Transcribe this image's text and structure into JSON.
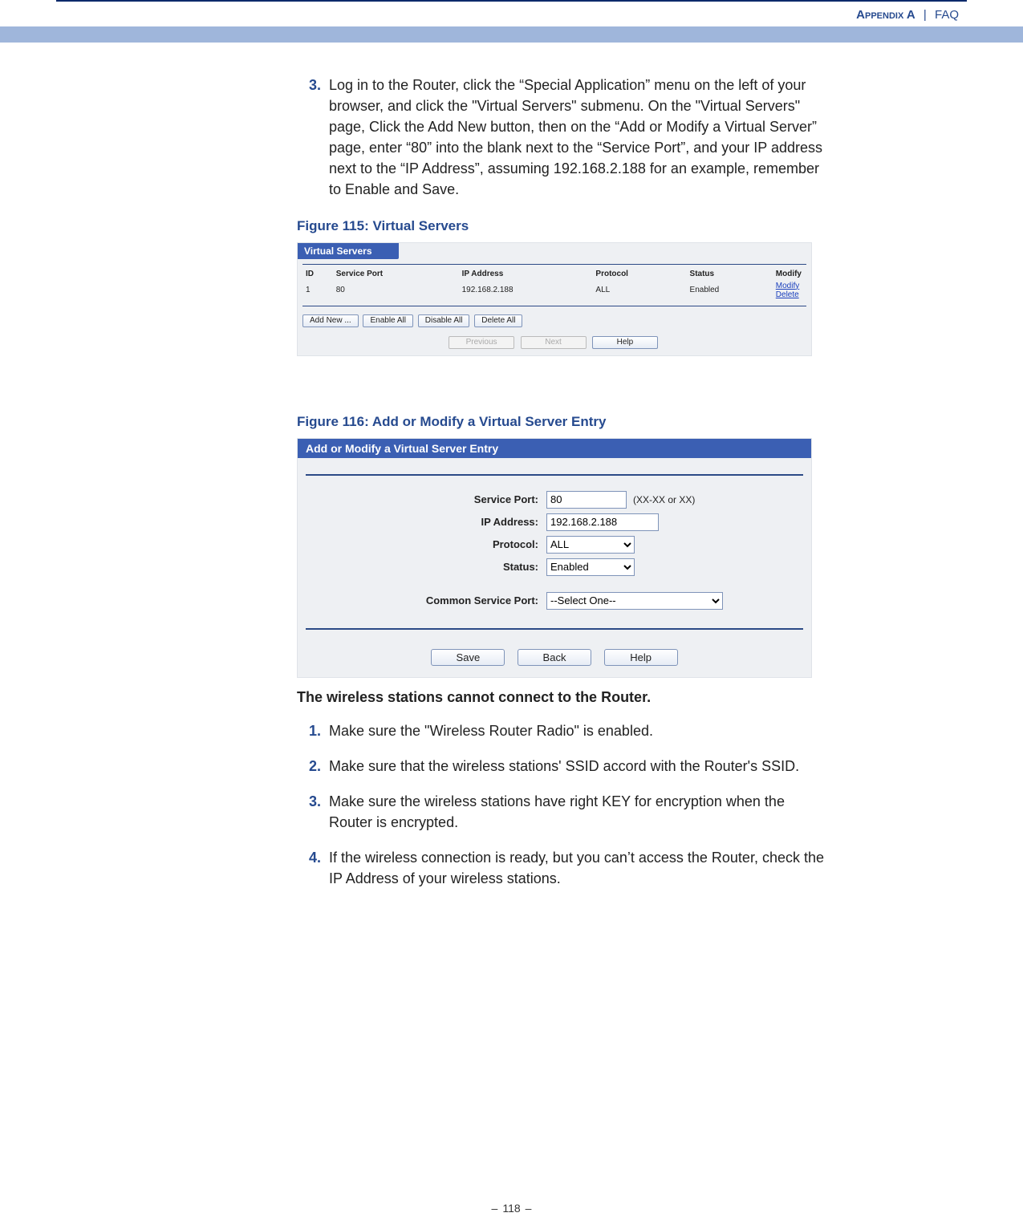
{
  "header": {
    "appendix": "Appendix A",
    "sep": "|",
    "section": "FAQ"
  },
  "step3": {
    "num": "3.",
    "text": "Log in to the Router, click the “Special Application” menu on the left of your browser, and click the \"Virtual Servers\" submenu. On the \"Virtual Servers\" page, Click the Add New button, then on the “Add or Modify a Virtual Server” page, enter “80” into the blank next to the “Service Port”, and your IP address next to the “IP Address”, assuming 192.168.2.188 for an example, remember to Enable and Save."
  },
  "fig115": {
    "caption": "Figure 115:  Virtual Servers",
    "title": "Virtual Servers",
    "cols": {
      "id": "ID",
      "sp": "Service Port",
      "ip": "IP Address",
      "proto": "Protocol",
      "status": "Status",
      "modify": "Modify"
    },
    "row": {
      "id": "1",
      "sp": "80",
      "ip": "192.168.2.188",
      "proto": "ALL",
      "status": "Enabled",
      "modify": "Modify",
      "delete": "Delete"
    },
    "btns": {
      "add": "Add New ...",
      "ena": "Enable All",
      "dis": "Disable All",
      "del": "Delete All"
    },
    "nav": {
      "prev": "Previous",
      "next": "Next",
      "help": "Help"
    }
  },
  "fig116": {
    "caption": "Figure 116:  Add or Modify a Virtual Server Entry",
    "title": "Add or Modify a Virtual Server Entry",
    "labels": {
      "sp": "Service Port:",
      "ip": "IP Address:",
      "proto": "Protocol:",
      "status": "Status:",
      "csp": "Common Service Port:"
    },
    "values": {
      "sp": "80",
      "sp_hint": "(XX-XX or XX)",
      "ip": "192.168.2.188"
    },
    "proto_opts": [
      "ALL"
    ],
    "status_opts": [
      "Enabled"
    ],
    "csp_opts": [
      "--Select One--"
    ],
    "btns": {
      "save": "Save",
      "back": "Back",
      "help": "Help"
    }
  },
  "subhead": "The wireless stations cannot connect to the Router.",
  "steps": {
    "s1": {
      "num": "1.",
      "text": "Make sure the \"Wireless Router Radio\" is enabled."
    },
    "s2": {
      "num": "2.",
      "text": "Make sure that the wireless stations' SSID accord with the Router's SSID."
    },
    "s3": {
      "num": "3.",
      "text": "Make sure the wireless stations have right KEY for encryption when the Router is encrypted."
    },
    "s4": {
      "num": "4.",
      "text": "If the wireless connection is ready, but you can’t access the Router, check the IP Address of your wireless stations."
    }
  },
  "footer": {
    "page": "118"
  }
}
